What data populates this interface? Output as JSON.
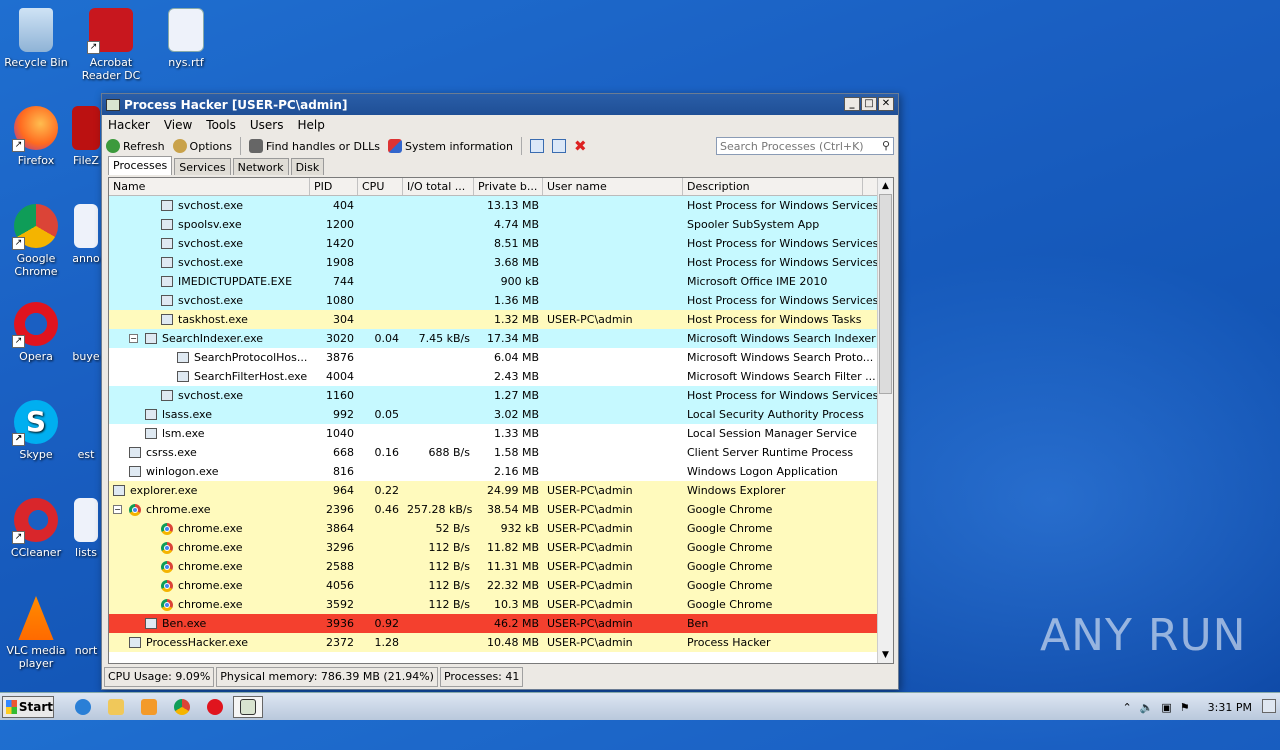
{
  "desktop": {
    "icons": [
      {
        "label": "Recycle Bin"
      },
      {
        "label": "Acrobat Reader DC"
      },
      {
        "label": "nys.rtf"
      },
      {
        "label": "Firefox"
      },
      {
        "label": "FileZ"
      },
      {
        "label": "Google Chrome"
      },
      {
        "label": "anno"
      },
      {
        "label": "Opera"
      },
      {
        "label": "buye"
      },
      {
        "label": "Skype"
      },
      {
        "label": "est"
      },
      {
        "label": "CCleaner"
      },
      {
        "label": "lists"
      },
      {
        "label": "VLC media player"
      },
      {
        "label": "nort"
      }
    ],
    "watermark": "ANY RUN"
  },
  "window": {
    "title": "Process Hacker [USER-PC\\admin]",
    "menu": [
      "Hacker",
      "View",
      "Tools",
      "Users",
      "Help"
    ],
    "toolbar": {
      "refresh": "Refresh",
      "options": "Options",
      "find": "Find handles or DLLs",
      "sysinfo": "System information"
    },
    "search_placeholder": "Search Processes (Ctrl+K)",
    "tabs": [
      "Processes",
      "Services",
      "Network",
      "Disk"
    ],
    "columns": [
      "Name",
      "PID",
      "CPU",
      "I/O total ...",
      "Private b...",
      "User name",
      "Description"
    ],
    "rows": [
      {
        "name": "svchost.exe",
        "pid": "404",
        "cpu": "",
        "io": "",
        "priv": "13.13 MB",
        "user": "",
        "desc": "Host Process for Windows Services",
        "bg": "cyan",
        "indent": 3,
        "icon": "proc"
      },
      {
        "name": "spoolsv.exe",
        "pid": "1200",
        "cpu": "",
        "io": "",
        "priv": "4.74 MB",
        "user": "",
        "desc": "Spooler SubSystem App",
        "bg": "cyan",
        "indent": 3,
        "icon": "proc"
      },
      {
        "name": "svchost.exe",
        "pid": "1420",
        "cpu": "",
        "io": "",
        "priv": "8.51 MB",
        "user": "",
        "desc": "Host Process for Windows Services",
        "bg": "cyan",
        "indent": 3,
        "icon": "proc"
      },
      {
        "name": "svchost.exe",
        "pid": "1908",
        "cpu": "",
        "io": "",
        "priv": "3.68 MB",
        "user": "",
        "desc": "Host Process for Windows Services",
        "bg": "cyan",
        "indent": 3,
        "icon": "proc"
      },
      {
        "name": "IMEDICTUPDATE.EXE",
        "pid": "744",
        "cpu": "",
        "io": "",
        "priv": "900 kB",
        "user": "",
        "desc": "Microsoft Office IME 2010",
        "bg": "cyan",
        "indent": 3,
        "icon": "proc"
      },
      {
        "name": "svchost.exe",
        "pid": "1080",
        "cpu": "",
        "io": "",
        "priv": "1.36 MB",
        "user": "",
        "desc": "Host Process for Windows Services",
        "bg": "cyan",
        "indent": 3,
        "icon": "proc"
      },
      {
        "name": "taskhost.exe",
        "pid": "304",
        "cpu": "",
        "io": "",
        "priv": "1.32 MB",
        "user": "USER-PC\\admin",
        "desc": "Host Process for Windows Tasks",
        "bg": "yellow",
        "indent": 3,
        "icon": "proc"
      },
      {
        "name": "SearchIndexer.exe",
        "pid": "3020",
        "cpu": "0.04",
        "io": "7.45 kB/s",
        "priv": "17.34 MB",
        "user": "",
        "desc": "Microsoft Windows Search Indexer",
        "bg": "cyan",
        "indent": 2,
        "icon": "proc",
        "expand": "−"
      },
      {
        "name": "SearchProtocolHos...",
        "pid": "3876",
        "cpu": "",
        "io": "",
        "priv": "6.04 MB",
        "user": "",
        "desc": "Microsoft Windows Search Proto...",
        "bg": "white",
        "indent": 4,
        "icon": "proc"
      },
      {
        "name": "SearchFilterHost.exe",
        "pid": "4004",
        "cpu": "",
        "io": "",
        "priv": "2.43 MB",
        "user": "",
        "desc": "Microsoft Windows Search Filter ...",
        "bg": "white",
        "indent": 4,
        "icon": "proc"
      },
      {
        "name": "svchost.exe",
        "pid": "1160",
        "cpu": "",
        "io": "",
        "priv": "1.27 MB",
        "user": "",
        "desc": "Host Process for Windows Services",
        "bg": "cyan",
        "indent": 3,
        "icon": "proc"
      },
      {
        "name": "lsass.exe",
        "pid": "992",
        "cpu": "0.05",
        "io": "",
        "priv": "3.02 MB",
        "user": "",
        "desc": "Local Security Authority Process",
        "bg": "cyan",
        "indent": 2,
        "icon": "proc"
      },
      {
        "name": "lsm.exe",
        "pid": "1040",
        "cpu": "",
        "io": "",
        "priv": "1.33 MB",
        "user": "",
        "desc": "Local Session Manager Service",
        "bg": "white",
        "indent": 2,
        "icon": "proc"
      },
      {
        "name": "csrss.exe",
        "pid": "668",
        "cpu": "0.16",
        "io": "688 B/s",
        "priv": "1.58 MB",
        "user": "",
        "desc": "Client Server Runtime Process",
        "bg": "white",
        "indent": 1,
        "icon": "proc"
      },
      {
        "name": "winlogon.exe",
        "pid": "816",
        "cpu": "",
        "io": "",
        "priv": "2.16 MB",
        "user": "",
        "desc": "Windows Logon Application",
        "bg": "white",
        "indent": 1,
        "icon": "proc"
      },
      {
        "name": "explorer.exe",
        "pid": "964",
        "cpu": "0.22",
        "io": "",
        "priv": "24.99 MB",
        "user": "USER-PC\\admin",
        "desc": "Windows Explorer",
        "bg": "yellow",
        "indent": 0,
        "icon": "proc",
        "expand": "−"
      },
      {
        "name": "chrome.exe",
        "pid": "2396",
        "cpu": "0.46",
        "io": "257.28 kB/s",
        "priv": "38.54 MB",
        "user": "USER-PC\\admin",
        "desc": "Google Chrome",
        "bg": "yellow",
        "indent": 1,
        "icon": "chrome",
        "expand": "−"
      },
      {
        "name": "chrome.exe",
        "pid": "3864",
        "cpu": "",
        "io": "52 B/s",
        "priv": "932 kB",
        "user": "USER-PC\\admin",
        "desc": "Google Chrome",
        "bg": "yellow",
        "indent": 3,
        "icon": "chrome"
      },
      {
        "name": "chrome.exe",
        "pid": "3296",
        "cpu": "",
        "io": "112 B/s",
        "priv": "11.82 MB",
        "user": "USER-PC\\admin",
        "desc": "Google Chrome",
        "bg": "yellow",
        "indent": 3,
        "icon": "chrome"
      },
      {
        "name": "chrome.exe",
        "pid": "2588",
        "cpu": "",
        "io": "112 B/s",
        "priv": "11.31 MB",
        "user": "USER-PC\\admin",
        "desc": "Google Chrome",
        "bg": "yellow",
        "indent": 3,
        "icon": "chrome"
      },
      {
        "name": "chrome.exe",
        "pid": "4056",
        "cpu": "",
        "io": "112 B/s",
        "priv": "22.32 MB",
        "user": "USER-PC\\admin",
        "desc": "Google Chrome",
        "bg": "yellow",
        "indent": 3,
        "icon": "chrome"
      },
      {
        "name": "chrome.exe",
        "pid": "3592",
        "cpu": "",
        "io": "112 B/s",
        "priv": "10.3 MB",
        "user": "USER-PC\\admin",
        "desc": "Google Chrome",
        "bg": "yellow",
        "indent": 3,
        "icon": "chrome"
      },
      {
        "name": "Ben.exe",
        "pid": "3936",
        "cpu": "0.92",
        "io": "",
        "priv": "46.2 MB",
        "user": "USER-PC\\admin",
        "desc": "Ben",
        "bg": "red",
        "indent": 2,
        "icon": "proc"
      },
      {
        "name": "ProcessHacker.exe",
        "pid": "2372",
        "cpu": "1.28",
        "io": "",
        "priv": "10.48 MB",
        "user": "USER-PC\\admin",
        "desc": "Process Hacker",
        "bg": "yellow",
        "indent": 1,
        "icon": "proc"
      }
    ],
    "status": {
      "cpu": "CPU Usage: 9.09%",
      "memory": "Physical memory: 786.39 MB (21.94%)",
      "processes": "Processes: 41"
    }
  },
  "taskbar": {
    "start": "Start",
    "clock": "3:31 PM"
  },
  "colors": {
    "service_row": "#c6f9ff",
    "user_row": "#fffabd",
    "highlight_row": "#f4402e"
  }
}
